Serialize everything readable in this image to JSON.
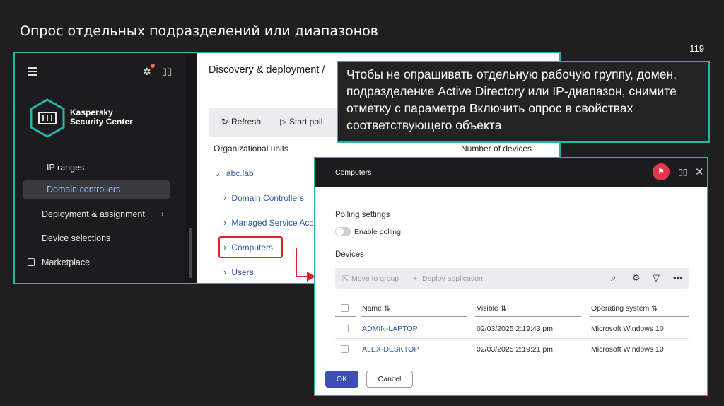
{
  "slide": {
    "title": "Опрос отдельных подразделений или диапазонов",
    "page_number": "119"
  },
  "sidebar": {
    "brand_line1": "Kaspersky",
    "brand_line2": "Security Center",
    "items": [
      {
        "label": "IP ranges"
      },
      {
        "label": "Domain controllers"
      },
      {
        "label": "Deployment & assignment"
      },
      {
        "label": "Device selections"
      },
      {
        "label": "Marketplace"
      }
    ],
    "active_item": "Domain controllers"
  },
  "main": {
    "title": "Discovery & deployment /",
    "toolbar": {
      "refresh": "Refresh",
      "start_poll": "Start poll"
    },
    "columns": {
      "org_units": "Organizational units",
      "num_devices": "Number of devices"
    },
    "tree": [
      {
        "label": "abc.lab",
        "arrow": "⌄"
      },
      {
        "label": "Domain Controllers",
        "arrow": "›"
      },
      {
        "label": "Managed Service Acc",
        "arrow": "›"
      },
      {
        "label": "Computers",
        "arrow": "›"
      },
      {
        "label": "Users",
        "arrow": "›"
      }
    ]
  },
  "callout": {
    "text": "Чтобы не опрашивать отдельную рабочую группу, домен, подразделение Active Directory или IP-диапазон, снимите отметку с параметра Включить опрос в свойствах соответствующего объекта"
  },
  "dialog": {
    "title": "Computers",
    "polling_settings": "Polling settings",
    "enable_polling": "Enable polling",
    "enable_polling_on": false,
    "devices": "Devices",
    "toolbar": {
      "move_to_group": "Move to group",
      "deploy_application": "Deploy application"
    },
    "columns": {
      "name": "Name ⇅",
      "visible": "Visible ⇅",
      "os": "Operating system ⇅"
    },
    "rows": [
      {
        "name": "ADMIN-LAPTOP",
        "visible": "02/03/2025 2:19:43 pm",
        "os": "Microsoft Windows 10"
      },
      {
        "name": "ALEX-DESKTOP",
        "visible": "02/03/2025 2:19:21 pm",
        "os": "Microsoft Windows 10"
      }
    ],
    "ok": "OK",
    "cancel": "Cancel"
  },
  "colors": {
    "accent_teal": "#2bb3a3",
    "highlight_red": "#e0202a",
    "primary_button": "#3d4fb3",
    "link_blue": "#2d5aa8"
  }
}
